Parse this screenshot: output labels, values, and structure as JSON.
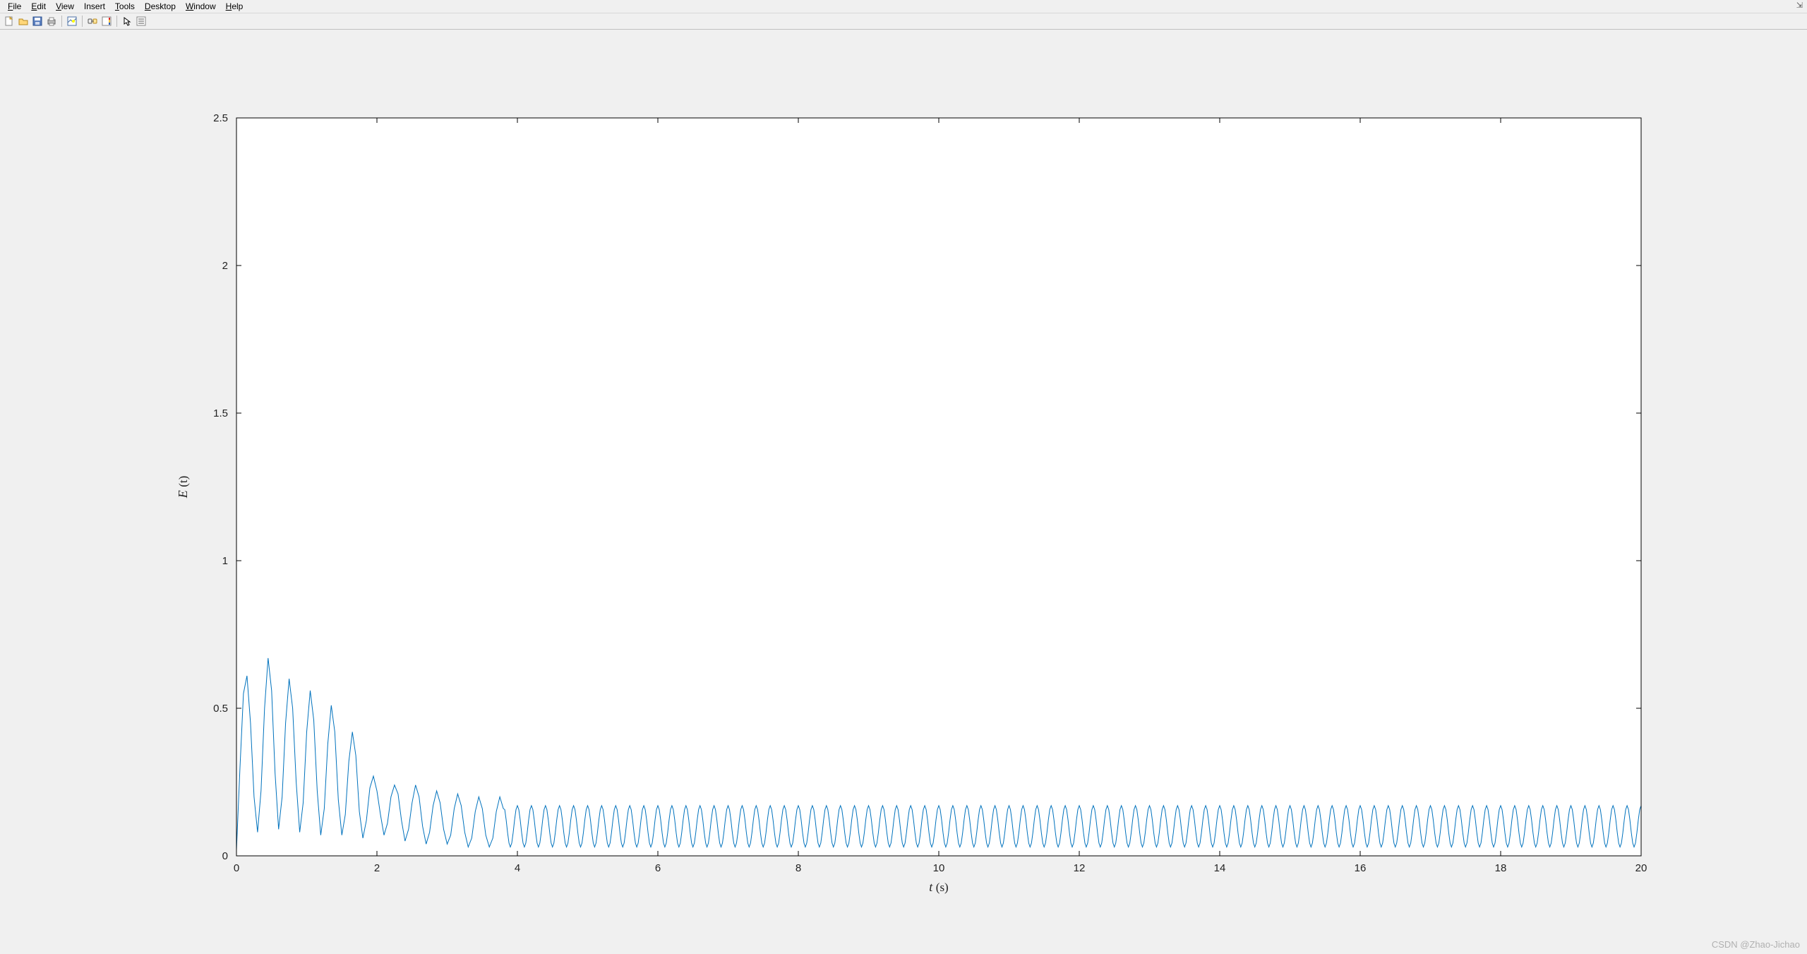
{
  "menu": {
    "file": "File",
    "edit": "Edit",
    "view": "View",
    "insert": "Insert",
    "tools": "Tools",
    "desktop": "Desktop",
    "window": "Window",
    "help": "Help",
    "corner": "⇲"
  },
  "toolbar_icons": {
    "new": "new-figure-icon",
    "open": "open-icon",
    "save": "save-icon",
    "print": "print-icon",
    "datacursor": "data-cursor-icon",
    "link": "link-icon",
    "colorbar": "colorbar-icon",
    "legend": "legend-icon",
    "arrow": "arrow-icon",
    "props": "plot-edit-icon"
  },
  "chart_data": {
    "type": "line",
    "title": "",
    "xlabel": "t (s)",
    "ylabel": "E (t)",
    "xlim": [
      0,
      20
    ],
    "ylim": [
      0,
      2.5
    ],
    "xticks": [
      0,
      2,
      4,
      6,
      8,
      10,
      12,
      14,
      16,
      18,
      20
    ],
    "yticks": [
      0,
      0.5,
      1,
      1.5,
      2,
      2.5
    ],
    "series": [
      {
        "name": "E(t)",
        "color": "#0072bd",
        "x": [
          0.0,
          0.05,
          0.1,
          0.15,
          0.2,
          0.25,
          0.3,
          0.35,
          0.4,
          0.45,
          0.5,
          0.55,
          0.6,
          0.65,
          0.7,
          0.75,
          0.8,
          0.85,
          0.9,
          0.95,
          1.0,
          1.05,
          1.1,
          1.15,
          1.2,
          1.25,
          1.3,
          1.35,
          1.4,
          1.45,
          1.5,
          1.55,
          1.6,
          1.65,
          1.7,
          1.75,
          1.8,
          1.85,
          1.9,
          1.95,
          2.0,
          2.05,
          2.1,
          2.15,
          2.2,
          2.25,
          2.3,
          2.35,
          2.4,
          2.45,
          2.5,
          2.55,
          2.6,
          2.65,
          2.7,
          2.75,
          2.8,
          2.85,
          2.9,
          2.95,
          3.0,
          3.05,
          3.1,
          3.15,
          3.2,
          3.25,
          3.3,
          3.35,
          3.4,
          3.45,
          3.5,
          3.55,
          3.6,
          3.65,
          3.7,
          3.75,
          3.8
        ],
        "y": [
          0.02,
          0.3,
          0.55,
          0.61,
          0.45,
          0.2,
          0.08,
          0.22,
          0.5,
          0.67,
          0.56,
          0.28,
          0.09,
          0.2,
          0.45,
          0.6,
          0.5,
          0.25,
          0.08,
          0.18,
          0.42,
          0.56,
          0.46,
          0.22,
          0.07,
          0.16,
          0.38,
          0.51,
          0.42,
          0.19,
          0.07,
          0.14,
          0.32,
          0.42,
          0.34,
          0.15,
          0.06,
          0.12,
          0.23,
          0.27,
          0.22,
          0.14,
          0.07,
          0.11,
          0.2,
          0.24,
          0.21,
          0.12,
          0.05,
          0.09,
          0.18,
          0.24,
          0.2,
          0.1,
          0.04,
          0.08,
          0.17,
          0.22,
          0.18,
          0.09,
          0.04,
          0.07,
          0.16,
          0.21,
          0.17,
          0.08,
          0.03,
          0.06,
          0.15,
          0.2,
          0.16,
          0.07,
          0.03,
          0.06,
          0.15,
          0.2,
          0.16
        ],
        "steady_state": {
          "x_start": 3.8,
          "x_end": 20.0,
          "period": 0.2,
          "min": 0.03,
          "max": 0.17,
          "mid": 0.095
        }
      }
    ]
  },
  "watermark": "CSDN @Zhao-Jichao"
}
